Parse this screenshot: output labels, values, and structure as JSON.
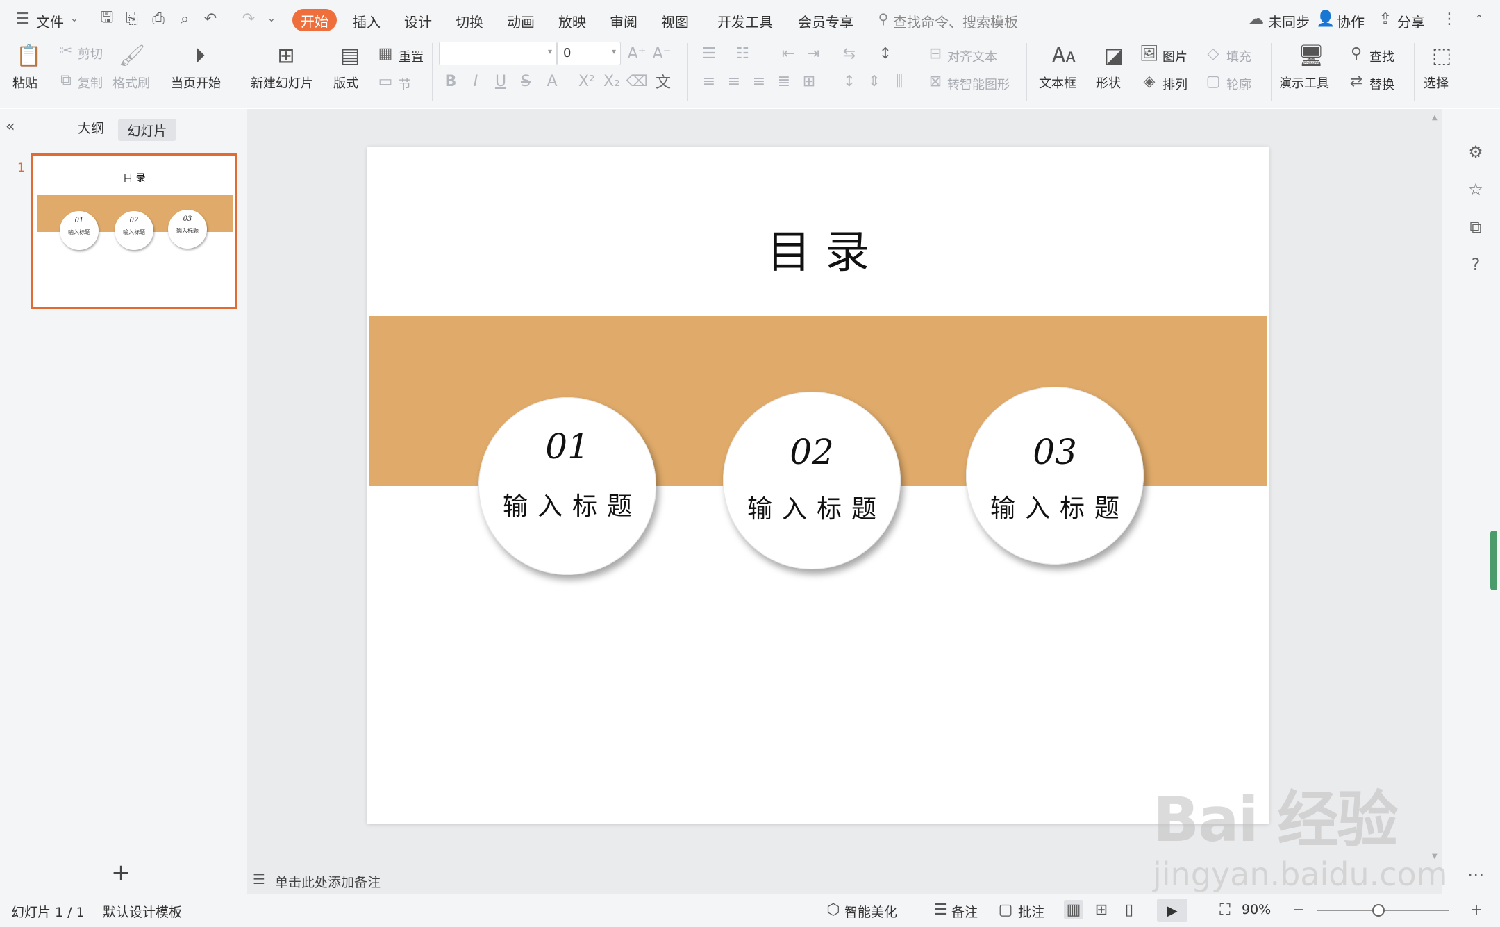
{
  "menubar": {
    "file": "文件",
    "tabs": [
      "开始",
      "插入",
      "设计",
      "切换",
      "动画",
      "放映",
      "审阅",
      "视图",
      "开发工具",
      "会员专享"
    ],
    "search_placeholder": "查找命令、搜索模板",
    "sync": "未同步",
    "collab": "协作",
    "share": "分享"
  },
  "ribbon": {
    "paste": "粘贴",
    "cut": "剪切",
    "copy": "复制",
    "format_painter": "格式刷",
    "from_current": "当页开始",
    "new_slide": "新建幻灯片",
    "layout": "版式",
    "reset": "重置",
    "section": "节",
    "font_size": "0",
    "align_text": "对齐文本",
    "smart_shape": "转智能图形",
    "textbox": "文本框",
    "shape": "形状",
    "picture": "图片",
    "arrange": "排列",
    "fill": "填充",
    "outline": "轮廓",
    "present_tools": "演示工具",
    "find": "查找",
    "replace": "替换",
    "select": "选择"
  },
  "left_panel": {
    "outline_tab": "大纲",
    "slides_tab": "幻灯片",
    "slide_number": "1"
  },
  "slide": {
    "title": "目      录",
    "items": [
      {
        "num": "01",
        "label": "输入标题"
      },
      {
        "num": "02",
        "label": "输入标题"
      },
      {
        "num": "03",
        "label": "输入标题"
      }
    ],
    "band_color": "#e0ab6a"
  },
  "notes": {
    "placeholder": "单击此处添加备注"
  },
  "status": {
    "slide_count": "幻灯片 1 / 1",
    "template": "默认设计模板",
    "beautify": "智能美化",
    "notes": "备注",
    "comments": "批注",
    "zoom": "90%"
  },
  "watermark": {
    "logo": "Bai 经验",
    "url": "jingyan.baidu.com"
  },
  "colors": {
    "accent": "#ee6f3c",
    "thumb_border": "#e26b34"
  }
}
